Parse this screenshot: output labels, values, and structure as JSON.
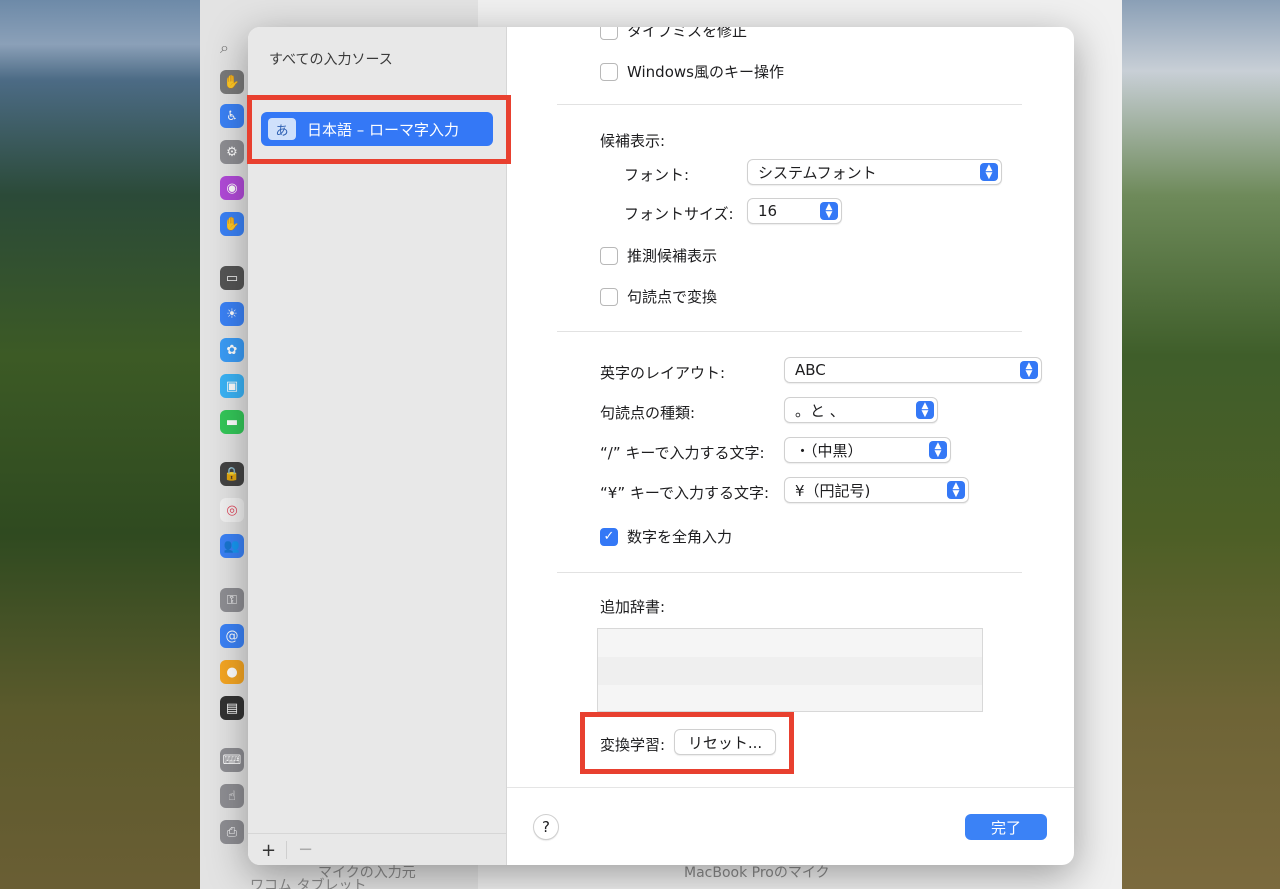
{
  "background": {
    "sidebar_icons": [
      "privacy-icon",
      "accessibility-icon",
      "control-center-icon",
      "siri-icon",
      "hand-icon",
      "display-icon",
      "brightness-icon",
      "screensaver-icon",
      "wallpaper-icon",
      "battery-icon",
      "lock-icon",
      "touchid-icon",
      "users-icon",
      "passwords-icon",
      "internet-accounts-icon",
      "game-center-icon",
      "wallet-icon",
      "keyboard-icon",
      "trackpad-icon",
      "printers-icon"
    ],
    "sidebar_footer": "ワコム タブレット",
    "main_row_label": "マイクの入力元",
    "main_row_value": "MacBook Proのマイク"
  },
  "sidebar": {
    "header": "すべての入力ソース",
    "selected_source": {
      "icon_char": "あ",
      "label": "日本語 – ローマ字入力"
    },
    "add": "+",
    "remove": "−"
  },
  "settings": {
    "typo_fix": {
      "label": "タイプミスを修正",
      "checked": false
    },
    "windows_keys": {
      "label": "Windows風のキー操作",
      "checked": false
    },
    "candidates": {
      "heading": "候補表示:",
      "font_label": "フォント:",
      "font_value": "システムフォント",
      "font_size_label": "フォントサイズ:",
      "font_size_value": "16"
    },
    "predictive": {
      "label": "推測候補表示",
      "checked": false
    },
    "punct_convert": {
      "label": "句読点で変換",
      "checked": false
    },
    "layout": {
      "label": "英字のレイアウト:",
      "value": "ABC"
    },
    "punct_type": {
      "label": "句読点の種類:",
      "value": "。と 、"
    },
    "slash_key": {
      "label": "“/” キーで入力する文字:",
      "value": "・（中黒）"
    },
    "yen_key": {
      "label": "“¥” キーで入力する文字:",
      "value": "¥（円記号)"
    },
    "fullwidth_numbers": {
      "label": "数字を全角入力",
      "checked": true,
      "check_char": "✓"
    },
    "dictionary": {
      "label": "追加辞書:"
    },
    "learning": {
      "label": "変換学習:",
      "reset_button": "リセット..."
    }
  },
  "footer": {
    "help": "?",
    "done": "完了"
  },
  "colors": {
    "accent": "#3478f6",
    "highlight": "#e8402f"
  }
}
